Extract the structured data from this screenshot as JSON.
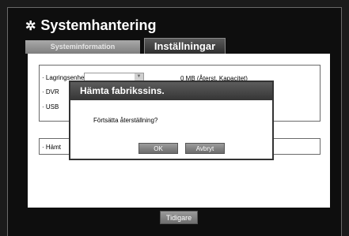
{
  "window": {
    "title": "Systemhantering",
    "title_icon": "gear-icon"
  },
  "tabs": [
    {
      "label": "Systeminformation",
      "active": false
    },
    {
      "label": "Inställningar",
      "active": true
    }
  ],
  "settings": {
    "storage_label": "· Lagringsenhet",
    "dvr_label": "· DVR",
    "usb_label": "· USB",
    "capacity_text": "0 MB (Återst. Kapacitet)",
    "factory_label": "· Hämt"
  },
  "footer": {
    "back_label": "Tidigare"
  },
  "dialog": {
    "title": "Hämta fabrikssins.",
    "message": "Förtsätta återställning?",
    "ok_label": "OK",
    "cancel_label": "Avbryt"
  }
}
